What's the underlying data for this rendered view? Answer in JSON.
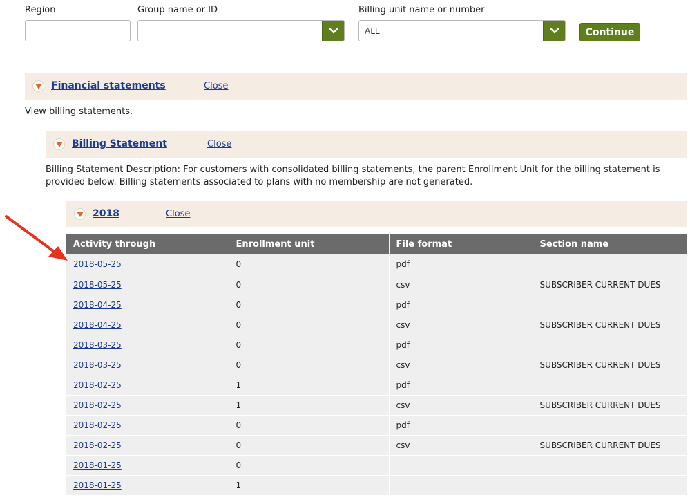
{
  "filters": {
    "region_label": "Region",
    "region_value": "",
    "group_label": "Group name or ID",
    "group_value": "",
    "billing_label": "Billing unit name or number",
    "billing_value": "ALL",
    "continue_label": "Continue"
  },
  "financial": {
    "title": "Financial statements",
    "close_label": "Close",
    "description": "View billing statements."
  },
  "billing": {
    "title": "Billing Statement",
    "close_label": "Close",
    "description_line1": "Billing Statement Description: For customers with consolidated billing statements, the parent Enrollment Unit for the billing statement is",
    "description_line2": "provided below. Billing statements associated to plans with no membership are not generated."
  },
  "year": {
    "title": "2018",
    "close_label": "Close"
  },
  "table": {
    "headers": [
      "Activity through",
      "Enrollment unit",
      "File format",
      "Section name"
    ],
    "rows": [
      {
        "date": "2018-05-25",
        "unit": "0",
        "format": "pdf",
        "section": ""
      },
      {
        "date": "2018-05-25",
        "unit": "0",
        "format": "csv",
        "section": "SUBSCRIBER CURRENT DUES"
      },
      {
        "date": "2018-04-25",
        "unit": "0",
        "format": "pdf",
        "section": ""
      },
      {
        "date": "2018-04-25",
        "unit": "0",
        "format": "csv",
        "section": "SUBSCRIBER CURRENT DUES"
      },
      {
        "date": "2018-03-25",
        "unit": "0",
        "format": "pdf",
        "section": ""
      },
      {
        "date": "2018-03-25",
        "unit": "0",
        "format": "csv",
        "section": "SUBSCRIBER CURRENT DUES"
      },
      {
        "date": "2018-02-25",
        "unit": "1",
        "format": "pdf",
        "section": ""
      },
      {
        "date": "2018-02-25",
        "unit": "1",
        "format": "csv",
        "section": "SUBSCRIBER CURRENT DUES"
      },
      {
        "date": "2018-02-25",
        "unit": "0",
        "format": "pdf",
        "section": ""
      },
      {
        "date": "2018-02-25",
        "unit": "0",
        "format": "csv",
        "section": "SUBSCRIBER CURRENT DUES"
      },
      {
        "date": "2018-01-25",
        "unit": "0",
        "format": "",
        "section": ""
      },
      {
        "date": "2018-01-25",
        "unit": "1",
        "format": "",
        "section": ""
      }
    ]
  },
  "colors": {
    "accent_green": "#5f7f1f",
    "panel_beige": "#f5ede4",
    "link_blue": "#1a3a8f",
    "header_gray": "#6b6b6b",
    "annotation_red": "#e8321e"
  }
}
